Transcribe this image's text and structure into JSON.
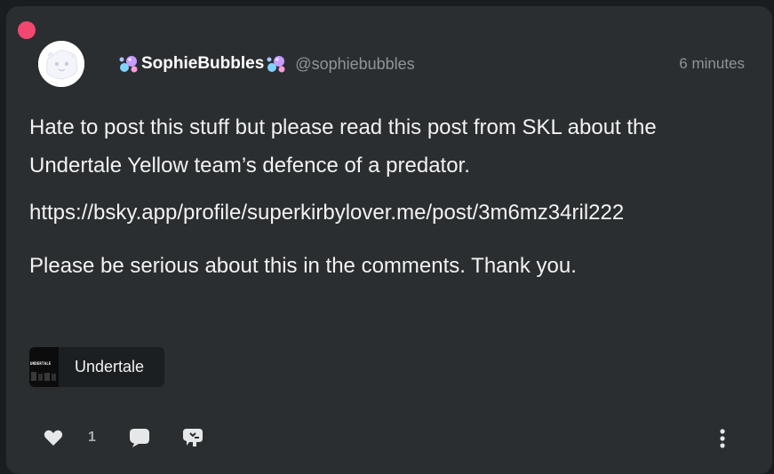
{
  "post": {
    "display_name": "SophieBubbles",
    "handle": "@sophiebubbles",
    "timestamp": "6 minutes",
    "paragraphs": [
      "Hate to post this stuff but please read this post from SKL about the Undertale Yellow team’s defence of a predator.",
      "https://bsky.app/profile/superkirbylover.me/post/3m6mz34ril222",
      "Please be serious about this in the comments. Thank you."
    ],
    "tag": {
      "label": "Undertale",
      "thumb_text": "UNDERTALE"
    },
    "actions": {
      "like_count": "1"
    }
  },
  "icons": {
    "unread": "unread-dot",
    "name_decoration": "bubbles-icon",
    "like": "heart-icon",
    "comment": "comment-icon",
    "reblog": "reblog-icon",
    "more": "vertical-dots-icon"
  },
  "colors": {
    "card_bg": "#2a2e30",
    "unread_dot": "#f2476f",
    "text_primary": "#f2f2f2",
    "text_muted": "#8f9496",
    "tag_bg": "#1c1f21"
  }
}
